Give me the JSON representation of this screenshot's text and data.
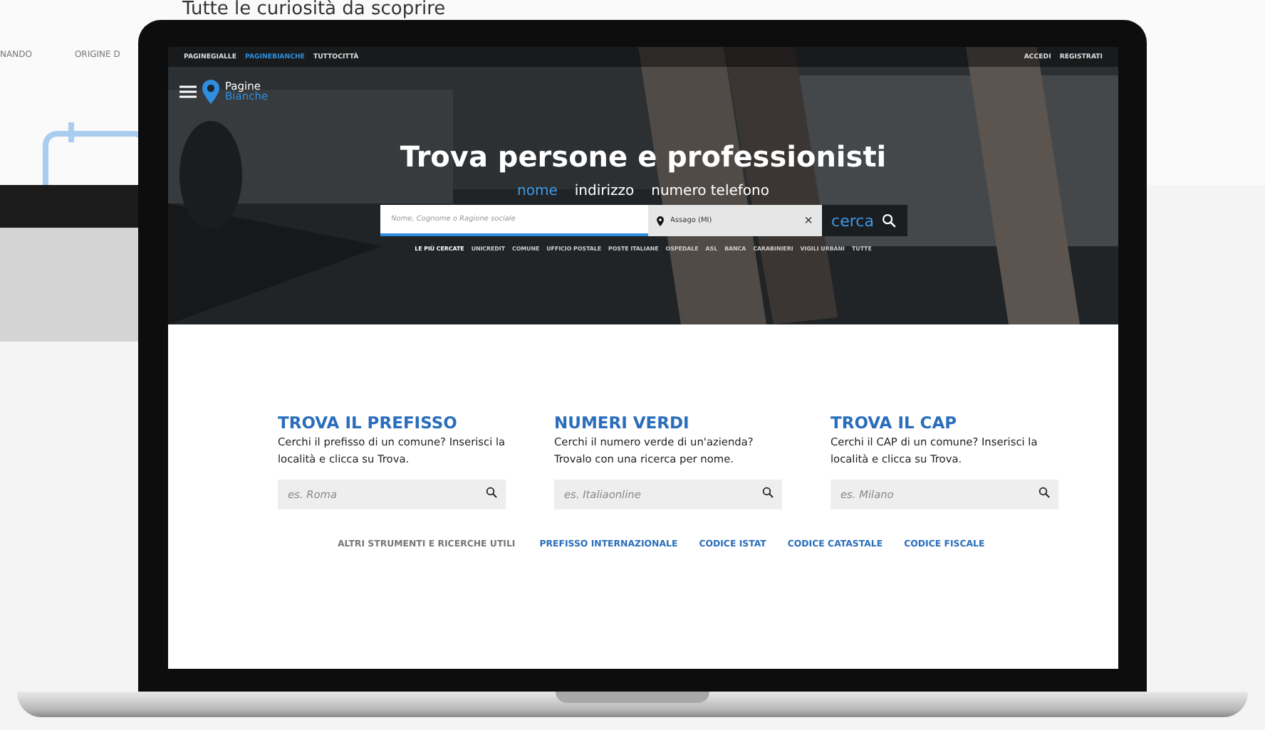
{
  "backdrop": {
    "heading": "Tutte le curiosità da scoprire",
    "tabs": [
      "NANDO",
      "ORIGINE D"
    ]
  },
  "topbar": {
    "brands": [
      {
        "label": "PAGINEGIALLE",
        "selected": false
      },
      {
        "label": "PAGINEBIANCHE",
        "selected": true
      },
      {
        "label": "TUTTOCITTÀ",
        "selected": false
      }
    ],
    "account": [
      "ACCEDI",
      "REGISTRATI"
    ]
  },
  "logo": {
    "line1": "Pagine",
    "line2": "Bianche"
  },
  "hero": {
    "title": "Trova persone e professionisti",
    "modes": [
      {
        "label": "nome",
        "selected": true
      },
      {
        "label": "indirizzo",
        "selected": false
      },
      {
        "label": "numero telefono",
        "selected": false
      }
    ],
    "name_field": {
      "placeholder": "Nome, Cognome o Ragione sociale"
    },
    "place_field": {
      "value": "Assago (MI)"
    },
    "clear": "×",
    "search_button": "cerca",
    "popular_label": "LE PIÙ CERCATE",
    "popular": [
      "UNICREDIT",
      "COMUNE",
      "UFFICIO POSTALE",
      "POSTE ITALIANE",
      "OSPEDALE",
      "ASL",
      "BANCA",
      "CARABINIERI",
      "VIGILI URBANI",
      "TUTTE"
    ]
  },
  "tools": [
    {
      "title": "TROVA IL PREFISSO",
      "description": "Cerchi il prefisso di un comune? Inserisci la località e clicca su Trova.",
      "placeholder": "es. Roma"
    },
    {
      "title": "NUMERI VERDI",
      "description": "Cerchi il numero verde di un'azienda? Trovalo con una ricerca per nome.",
      "placeholder": "es. Italiaonline"
    },
    {
      "title": "TROVA IL CAP",
      "description": "Cerchi il CAP di un comune? Inserisci la località e clicca su Trova.",
      "placeholder": "es. Milano"
    }
  ],
  "links": {
    "label": "ALTRI STRUMENTI E RICERCHE UTILI",
    "items": [
      "PREFISSO INTERNAZIONALE",
      "CODICE ISTAT",
      "CODICE CATASTALE",
      "CODICE FISCALE"
    ]
  }
}
